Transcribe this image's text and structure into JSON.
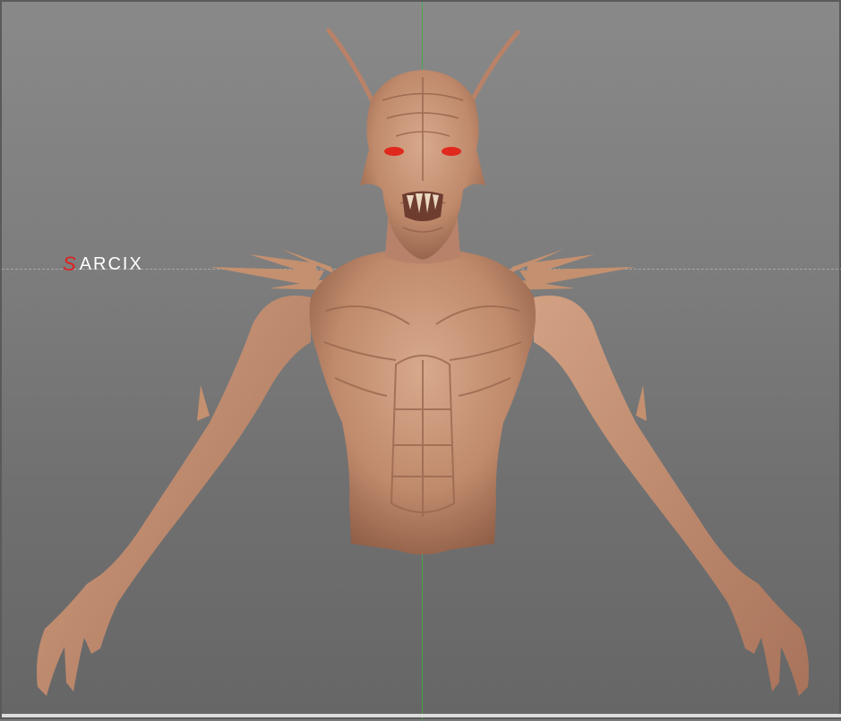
{
  "logo": {
    "mark": "S",
    "text": "ARCIX"
  },
  "colors": {
    "skin": "#c08a6c",
    "skin_dark": "#8e5d45",
    "skin_light": "#d8a98c",
    "eyes": "#e0281c",
    "axis_green": "#45a845",
    "logo_red": "#e02020"
  }
}
